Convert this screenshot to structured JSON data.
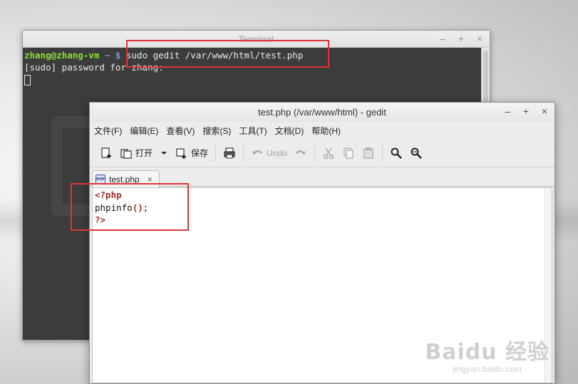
{
  "terminal": {
    "title": "Terminal",
    "controls": [
      "–",
      "+",
      "×"
    ],
    "prompt_user": "zhang@zhang-vm",
    "prompt_path": " ~ $ ",
    "command": "sudo gedit /var/www/html/test.php",
    "sudo_prompt": "[sudo] password for zhang:"
  },
  "gedit": {
    "title": "test.php (/var/www/html) - gedit",
    "controls": [
      "–",
      "+",
      "×"
    ],
    "menu": [
      "文件(F)",
      "编辑(E)",
      "查看(V)",
      "搜索(S)",
      "工具(T)",
      "文档(D)",
      "帮助(H)"
    ],
    "toolbar": {
      "open_label": "打开",
      "save_label": "保存",
      "undo_label": "Undo"
    },
    "tab": {
      "icon_text": "PHP",
      "label": "test.php",
      "close": "×"
    },
    "code": {
      "line1": "<?php",
      "line2_func": "phpinfo",
      "line2_paren": "()",
      "line2_semi": ";",
      "line3": "?>"
    }
  },
  "watermark": {
    "brand": "Baidu 经验",
    "url": "jingyan.baidu.com"
  },
  "colors": {
    "highlight": "#e03434",
    "prompt_user": "#8ae234",
    "prompt_path": "#729fcf",
    "php_keyword": "#a52a2a"
  }
}
